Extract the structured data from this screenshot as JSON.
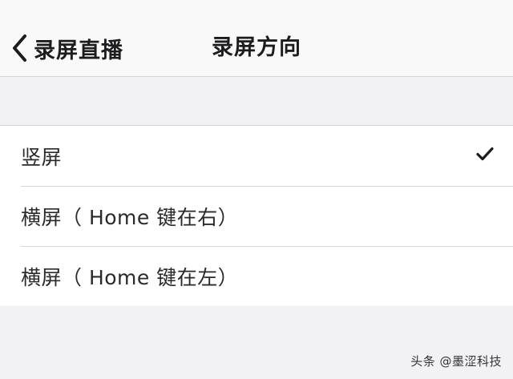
{
  "navbar": {
    "back_label": "录屏直播",
    "title": "录屏方向"
  },
  "options": [
    {
      "label": "竖屏",
      "selected": true
    },
    {
      "label": "横屏（ Home 键在右）",
      "selected": false
    },
    {
      "label": "横屏（ Home 键在左）",
      "selected": false
    }
  ],
  "watermark": "头条 @墨涩科技",
  "icons": {
    "back": "chevron-left-icon",
    "selected": "checkmark-icon"
  },
  "colors": {
    "text": "#2a2a2a",
    "separator": "#d6d6d6",
    "background": "#f2f2f4"
  }
}
